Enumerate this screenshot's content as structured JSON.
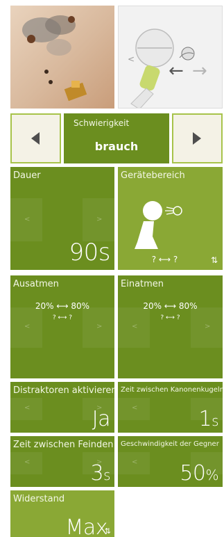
{
  "difficulty": {
    "label": "Schwierigkeit",
    "value": "brauch"
  },
  "tiles": {
    "duration": {
      "title": "Dauer",
      "value": "90s"
    },
    "device_range": {
      "title": "Gerätebereich",
      "range": "? ⟷ ?"
    },
    "exhale": {
      "title": "Ausatmen",
      "range": "20% ⟷ 80%",
      "sub": "? ⟷ ?"
    },
    "inhale": {
      "title": "Einatmen",
      "range": "20% ⟷ 80%",
      "sub": "? ⟷ ?"
    },
    "distractors": {
      "title": "Distraktoren aktivieren",
      "value": "Ja"
    },
    "cannonball_time": {
      "title": "Zeit zwischen Kanonenkugeln",
      "value": "1",
      "unit": "s"
    },
    "enemy_time": {
      "title": "Zeit zwischen Feinden",
      "value": "3",
      "unit": "s"
    },
    "enemy_speed": {
      "title": "Geschwindigkeit der Gegner",
      "value": "50",
      "unit": "%"
    },
    "resistance": {
      "title": "Widerstand",
      "value": "Max"
    }
  },
  "colors": {
    "tile": "#6b8e1f",
    "tile_light": "#8aa835",
    "nav_bg": "#f4f2e6",
    "nav_border": "#a7c34a"
  },
  "icons": [
    "game-preview-image",
    "breathing-character-image",
    "arrow-left-icon",
    "arrow-right-icon",
    "blowing-figure-icon",
    "link-icon",
    "chevron-left-icon",
    "chevron-right-icon"
  ]
}
